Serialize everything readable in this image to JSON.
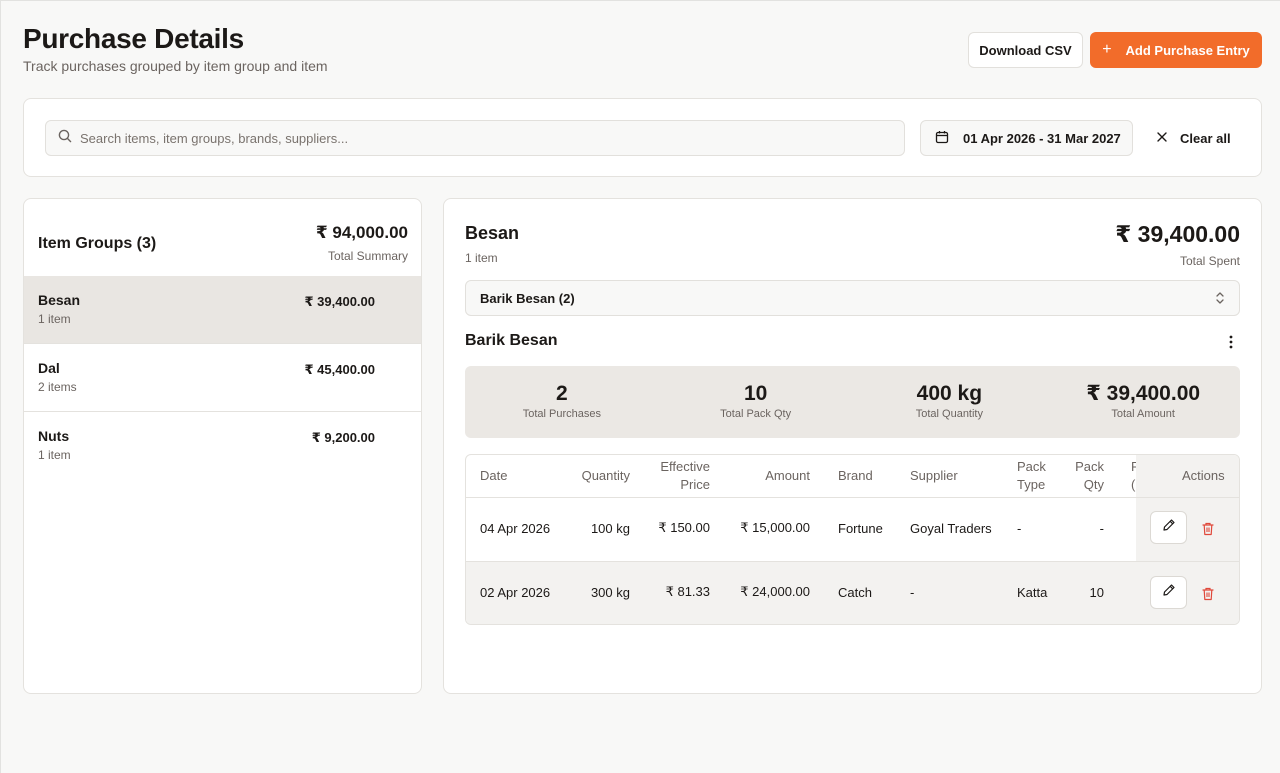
{
  "header": {
    "title": "Purchase Details",
    "subtitle": "Track purchases grouped by item group and item",
    "download_label": "Download CSV",
    "add_label": "Add Purchase Entry",
    "add_icon": "+"
  },
  "filters": {
    "search_placeholder": "Search items, item groups, brands, suppliers...",
    "date_range": "01 Apr 2026 - 31 Mar 2027",
    "clear_label": "Clear all"
  },
  "groups": {
    "title": "Item Groups (3)",
    "total": "₹ 94,000.00",
    "total_label": "Total Summary",
    "items": [
      {
        "name": "Besan",
        "count": "1 item",
        "amount": "₹ 39,400.00",
        "selected": true
      },
      {
        "name": "Dal",
        "count": "2 items",
        "amount": "₹ 45,400.00",
        "selected": false
      },
      {
        "name": "Nuts",
        "count": "1 item",
        "amount": "₹ 9,200.00",
        "selected": false
      }
    ]
  },
  "detail": {
    "name": "Besan",
    "count": "1 item",
    "total": "₹ 39,400.00",
    "total_label": "Total Spent",
    "item_select": "Barik Besan (2)",
    "item_title": "Barik Besan",
    "stats": [
      {
        "value": "2",
        "label": "Total Purchases"
      },
      {
        "value": "10",
        "label": "Total Pack Qty"
      },
      {
        "value": "400 kg",
        "label": "Total Quantity"
      },
      {
        "value": "₹ 39,400.00",
        "label": "Total Amount"
      }
    ],
    "table": {
      "headers": {
        "date": "Date",
        "quantity": "Quantity",
        "eff_price_1": "Effective",
        "eff_price_2": "Price",
        "amount": "Amount",
        "brand": "Brand",
        "supplier": "Supplier",
        "pack_type_1": "Pack",
        "pack_type_2": "Type",
        "pack_qty_1": "Pack",
        "pack_qty_2": "Qty",
        "cut_1": "F",
        "cut_2": "(",
        "actions": "Actions"
      },
      "rows": [
        {
          "date": "04 Apr 2026",
          "quantity": "100 kg",
          "price": "₹ 150.00",
          "amount": "₹ 15,000.00",
          "brand": "Fortune",
          "supplier": "Goyal Traders",
          "pack_type": "-",
          "pack_qty": "-"
        },
        {
          "date": "02 Apr 2026",
          "quantity": "300 kg",
          "price": "₹ 81.33",
          "amount": "₹ 24,000.00",
          "brand": "Catch",
          "supplier": "-",
          "pack_type": "Katta",
          "pack_qty": "10"
        }
      ]
    }
  },
  "colors": {
    "accent": "#f26c2a",
    "delete": "#e0483a",
    "selected_row": "#e9e6e2"
  }
}
